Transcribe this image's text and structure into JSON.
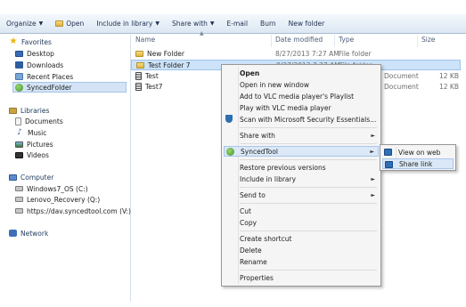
{
  "toolbar": {
    "organize": "Organize",
    "open": "Open",
    "include_in_library": "Include in library",
    "share_with": "Share with",
    "email": "E-mail",
    "burn": "Burn",
    "new_folder": "New folder"
  },
  "nav": {
    "favorites": "Favorites",
    "desktop": "Desktop",
    "downloads": "Downloads",
    "recent_places": "Recent Places",
    "syncedfolder": "SyncedFolder",
    "libraries": "Libraries",
    "documents": "Documents",
    "music": "Music",
    "pictures": "Pictures",
    "videos": "Videos",
    "computer": "Computer",
    "drive_c": "Windows7_OS (C:)",
    "drive_q": "Lenovo_Recovery (Q:)",
    "drive_v": "https://dav.syncedtool.com (V:)",
    "network": "Network"
  },
  "columns": {
    "name": "Name",
    "date_modified": "Date modified",
    "type": "Type",
    "size": "Size"
  },
  "files": [
    {
      "name": "New Folder",
      "date": "8/27/2013 7:27 AM",
      "type": "File folder",
      "size": ""
    },
    {
      "name": "Test Folder 7",
      "date": "8/27/2013 7:27 AM",
      "type": "File folder",
      "size": ""
    },
    {
      "name": "Test",
      "date": "",
      "type": "Document",
      "size": "12 KB"
    },
    {
      "name": "Test7",
      "date": "",
      "type": "Document",
      "size": "12 KB"
    }
  ],
  "context_menu": {
    "open": "Open",
    "open_new_window": "Open in new window",
    "add_vlc_playlist": "Add to VLC media player's Playlist",
    "play_vlc": "Play with VLC media player",
    "scan_mse": "Scan with Microsoft Security Essentials...",
    "share_with": "Share with",
    "syncedtool": "SyncedTool",
    "restore_previous": "Restore previous versions",
    "include_in_library": "Include in library",
    "send_to": "Send to",
    "cut": "Cut",
    "copy": "Copy",
    "create_shortcut": "Create shortcut",
    "delete": "Delete",
    "rename": "Rename",
    "properties": "Properties"
  },
  "submenu": {
    "view_on_web": "View on web",
    "share_link": "Share link"
  }
}
